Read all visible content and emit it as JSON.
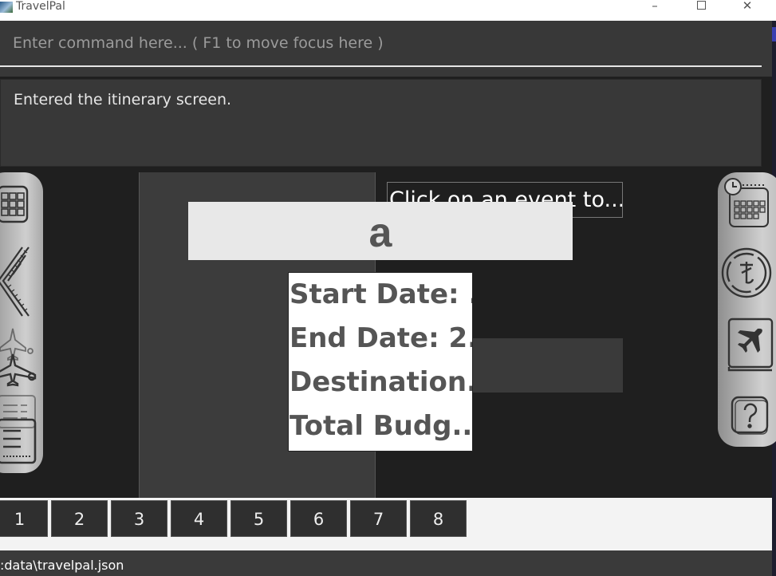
{
  "window": {
    "title": "TravelPal",
    "minimize": "–",
    "close": "✕"
  },
  "command": {
    "placeholder": "Enter command here... ( F1 to move focus here )",
    "value": ""
  },
  "result": {
    "text": "Entered the itinerary screen."
  },
  "hint": "Click on an event to...",
  "day_title": "a",
  "trip": {
    "start": "Start Date: ...",
    "end": "End Date: 2...",
    "destination": "Destination...",
    "budget": "Total Budg..."
  },
  "tabs": [
    "1",
    "2",
    "3",
    "4",
    "5",
    "6",
    "7",
    "8"
  ],
  "status": {
    "path": ":data\\travelpal.json"
  },
  "icons": {
    "left": [
      "calendar-icon",
      "runway-icon",
      "flight-icon",
      "inventory-icon"
    ],
    "right": [
      "schedule-icon",
      "currency-icon",
      "booking-icon",
      "help-icon"
    ]
  }
}
